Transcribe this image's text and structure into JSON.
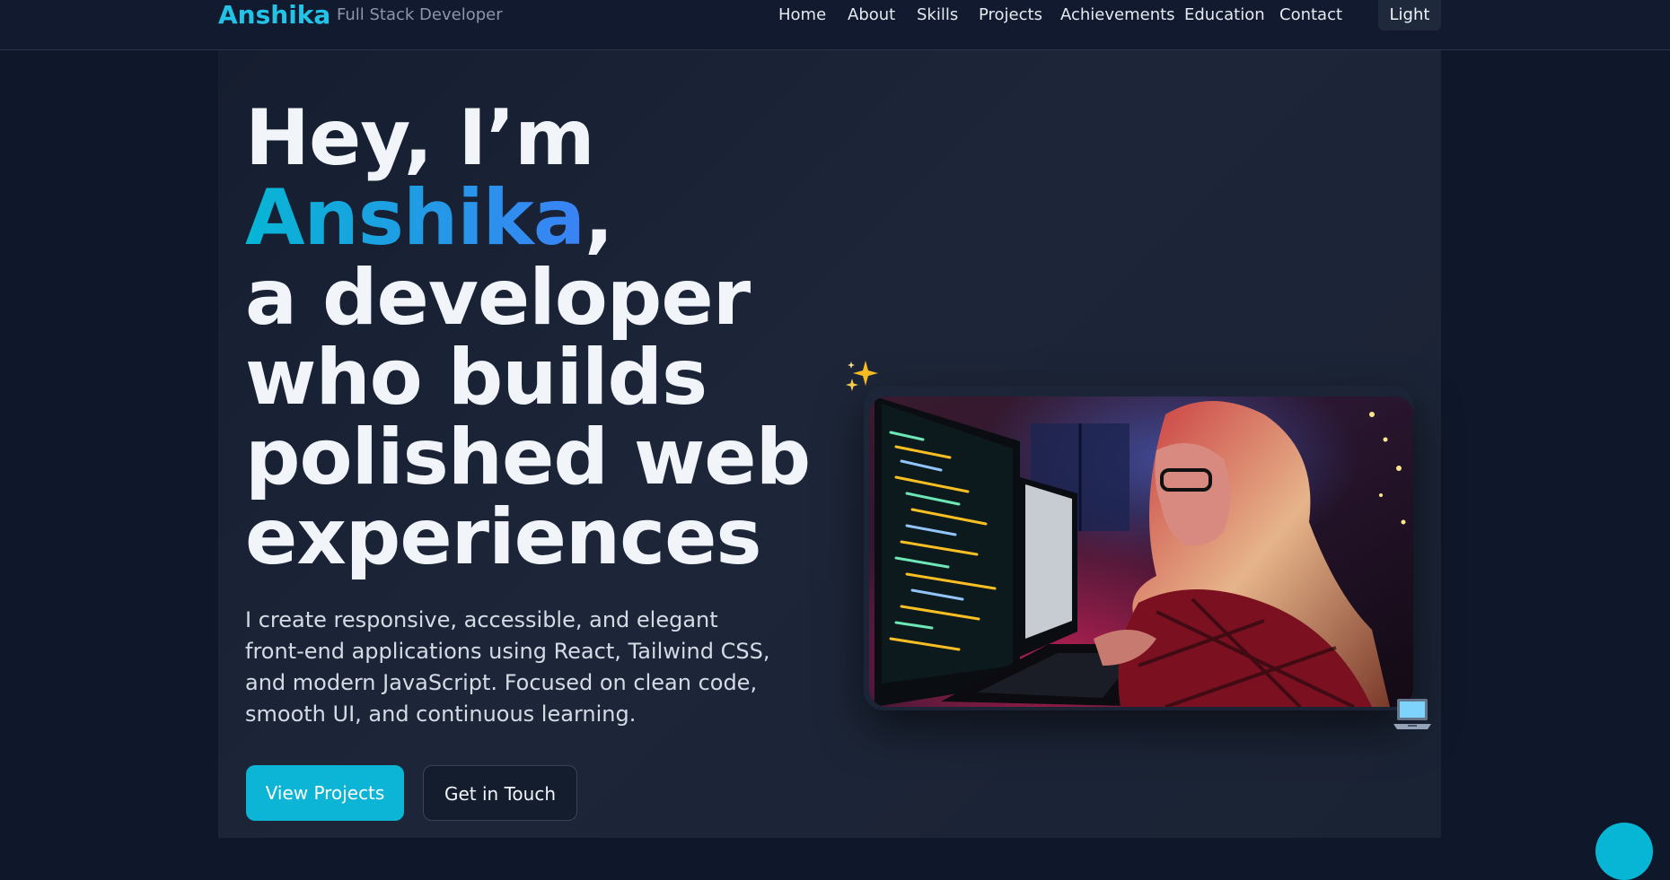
{
  "header": {
    "brand": "Anshika",
    "tagline": "Full Stack Developer",
    "nav": [
      "Home",
      "About",
      "Skills",
      "Projects",
      "Achievements",
      "Education",
      "Contact"
    ],
    "theme_toggle": "Light"
  },
  "hero": {
    "title_line1": "Hey, I’m",
    "title_name": "Anshika",
    "title_comma": ",",
    "title_rest_1": "a developer",
    "title_rest_2": "who builds",
    "title_rest_3": "polished web",
    "title_rest_4": "experiences",
    "description": "I create responsive, accessible, and elegant front-end applications using React, Tailwind CSS, and modern JavaScript. Focused on clean code, smooth UI, and continuous learning.",
    "primary_button": "View Projects",
    "secondary_button": "Get in Touch",
    "decor_icons": [
      "sparkles-icon",
      "laptop-icon"
    ]
  },
  "colors": {
    "accent": "#06b6d4",
    "accent_gradient_end": "#3b82f6",
    "background": "#0f172a",
    "panel": "#1a2334"
  }
}
